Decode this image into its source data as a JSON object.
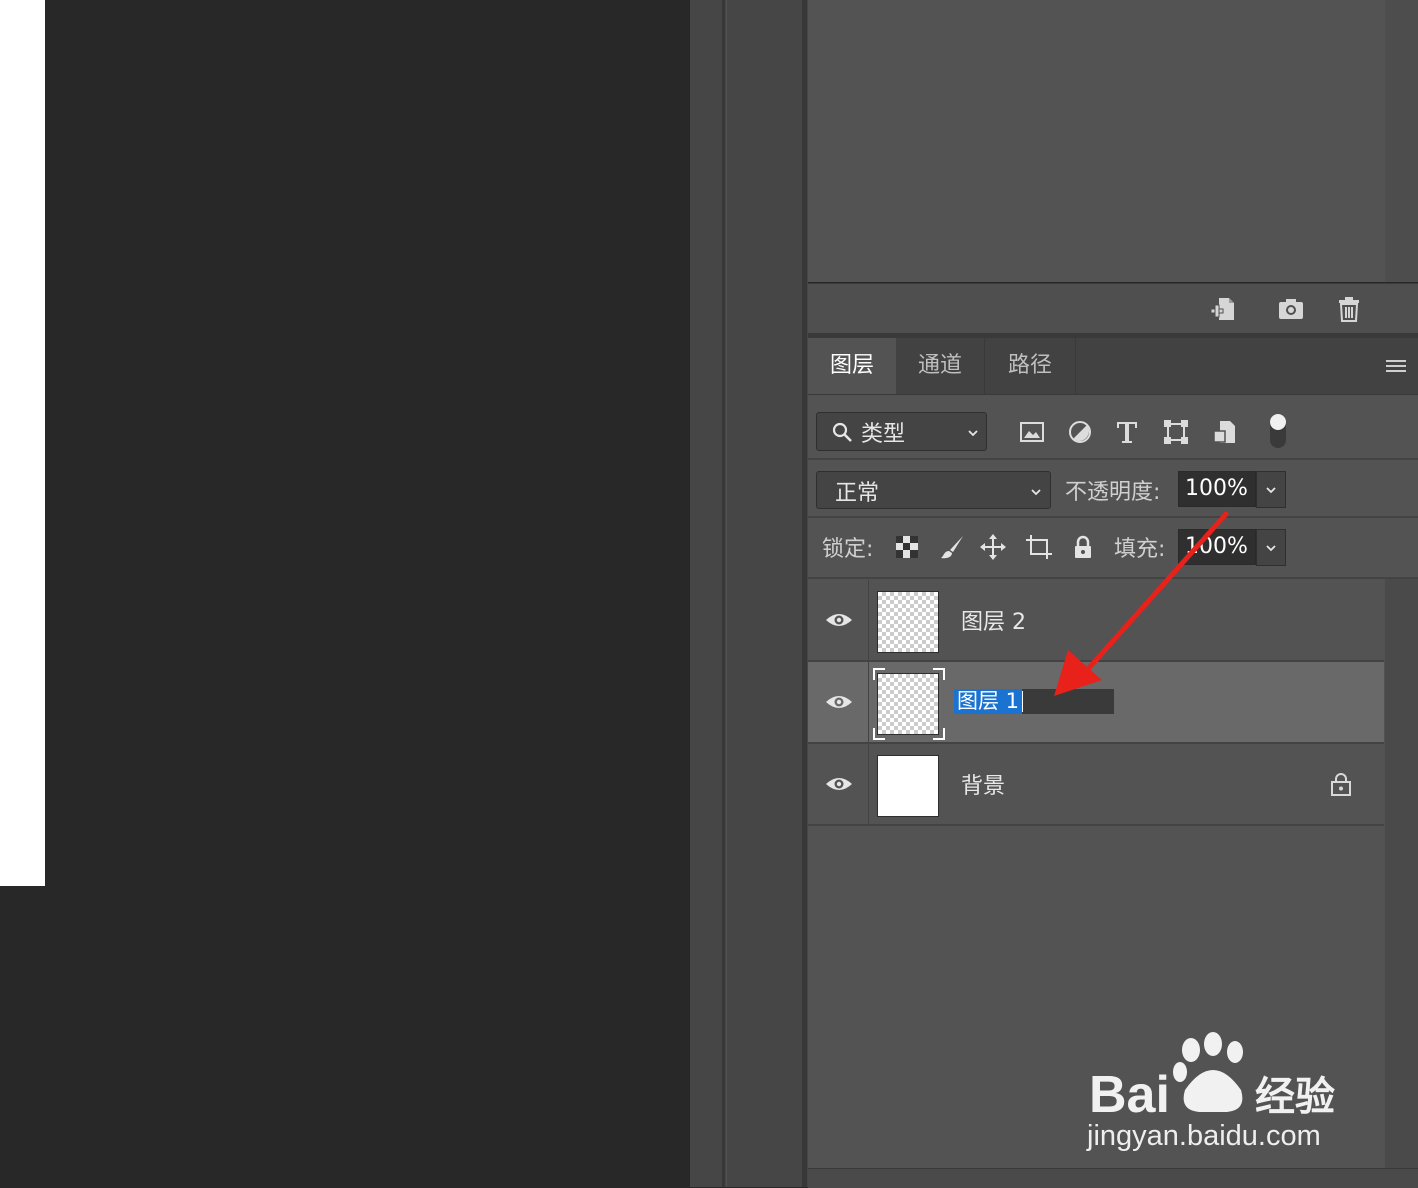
{
  "layers_panel": {
    "tabs": [
      {
        "label": "图层",
        "active": true
      },
      {
        "label": "通道",
        "active": false
      },
      {
        "label": "路径",
        "active": false
      }
    ],
    "filter": {
      "kind_label": "类型",
      "icons": [
        "image-filter-icon",
        "adjustment-filter-icon",
        "type-filter-icon",
        "shape-filter-icon",
        "smart-object-filter-icon",
        "filter-toggle-icon"
      ]
    },
    "blend_mode": "正常",
    "opacity_label": "不透明度:",
    "opacity_value": "100%",
    "lock_label": "锁定:",
    "lock_icons": [
      "lock-transparent-pixels-icon",
      "lock-image-pixels-icon",
      "lock-position-icon",
      "lock-artboard-icon",
      "lock-all-icon"
    ],
    "fill_label": "填充:",
    "fill_value": "100%",
    "layers": [
      {
        "name": "图层 2",
        "visible": true,
        "thumbnail": "transparent",
        "locked": false,
        "selected": false,
        "editing": false
      },
      {
        "name": "图层 1",
        "visible": true,
        "thumbnail": "transparent",
        "locked": false,
        "selected": true,
        "editing": true
      },
      {
        "name": "背景",
        "visible": true,
        "thumbnail": "white",
        "locked": true,
        "selected": false,
        "editing": false
      }
    ]
  },
  "upper_panel_footer_icons": [
    "new-snapshot-icon",
    "camera-icon",
    "trash-icon"
  ],
  "watermark": {
    "brand": "Bai du 经验",
    "url": "jingyan.baidu.com"
  },
  "colors": {
    "selection": "#1a73d0",
    "panel": "#535353",
    "canvas": "#282828",
    "arrow": "#e8221b"
  }
}
